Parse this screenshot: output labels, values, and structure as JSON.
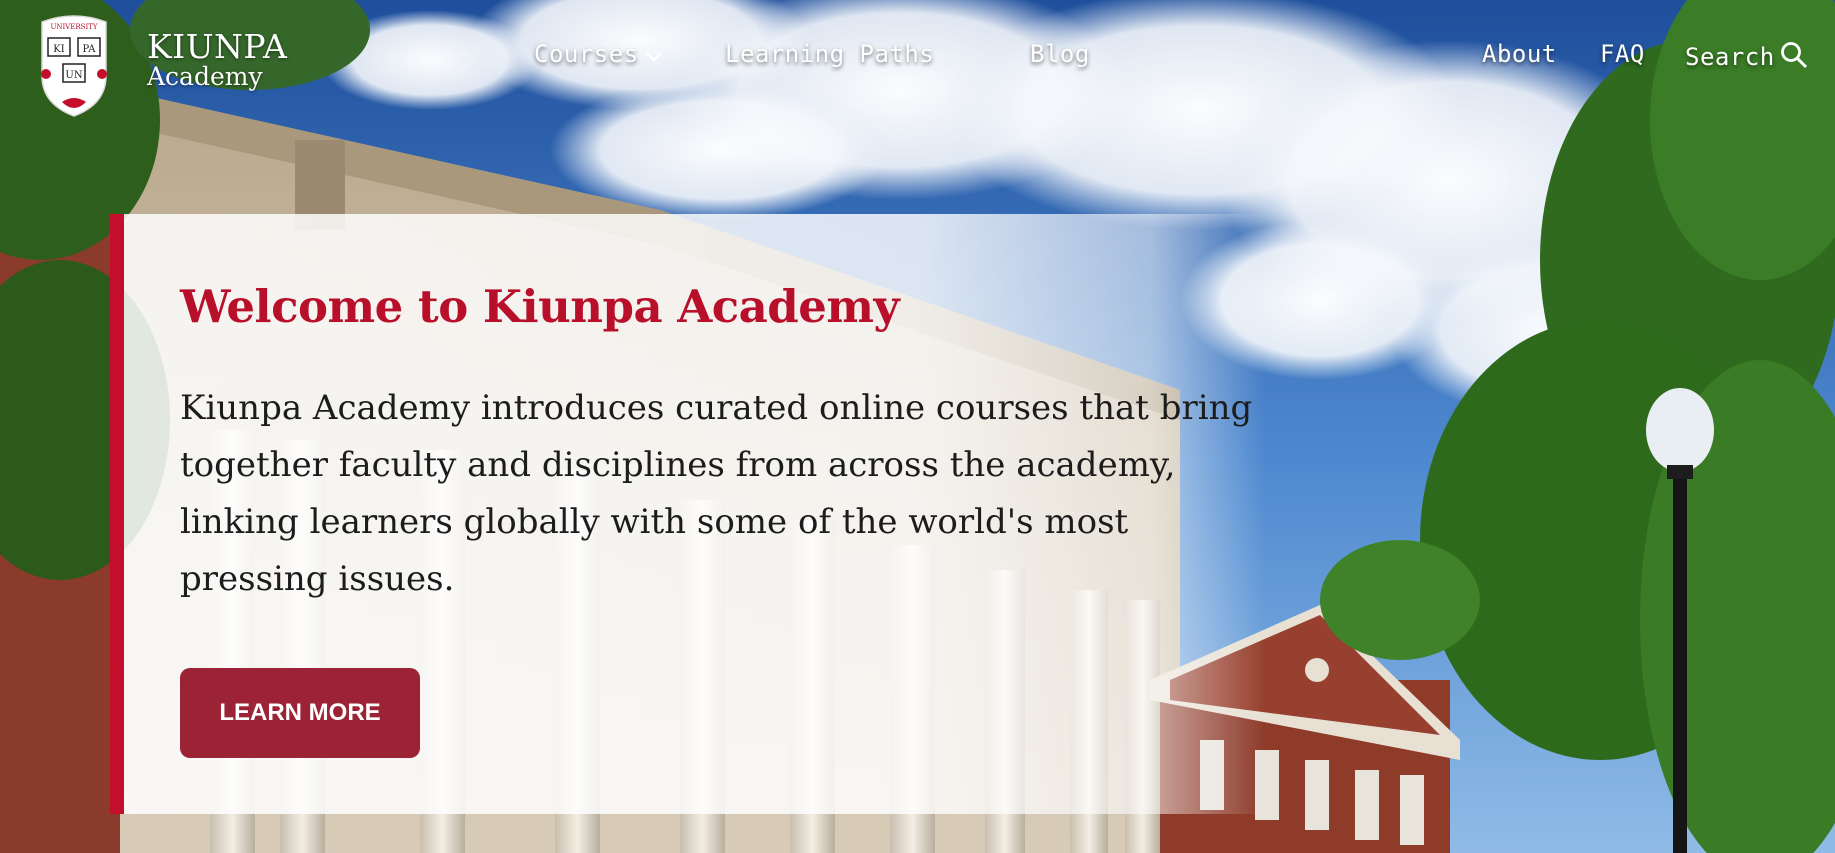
{
  "brand": {
    "name": "KIUNPA",
    "sub": "Academy",
    "seal_text": "UNIVERSITY"
  },
  "nav": {
    "courses": "Courses",
    "learning_paths": "Learning Paths",
    "blog": "Blog",
    "about": "About",
    "faq": "FAQ",
    "search": "Search"
  },
  "hero": {
    "title": "Welcome to Kiunpa Academy",
    "body": "Kiunpa Academy introduces curated online courses that bring together faculty and disciplines from across the academy, linking learners globally with some of the world's most pressing issues.",
    "cta": "LEARN MORE"
  },
  "colors": {
    "accent": "#c40e2b",
    "title": "#b8102b",
    "button": "#9b2335"
  }
}
